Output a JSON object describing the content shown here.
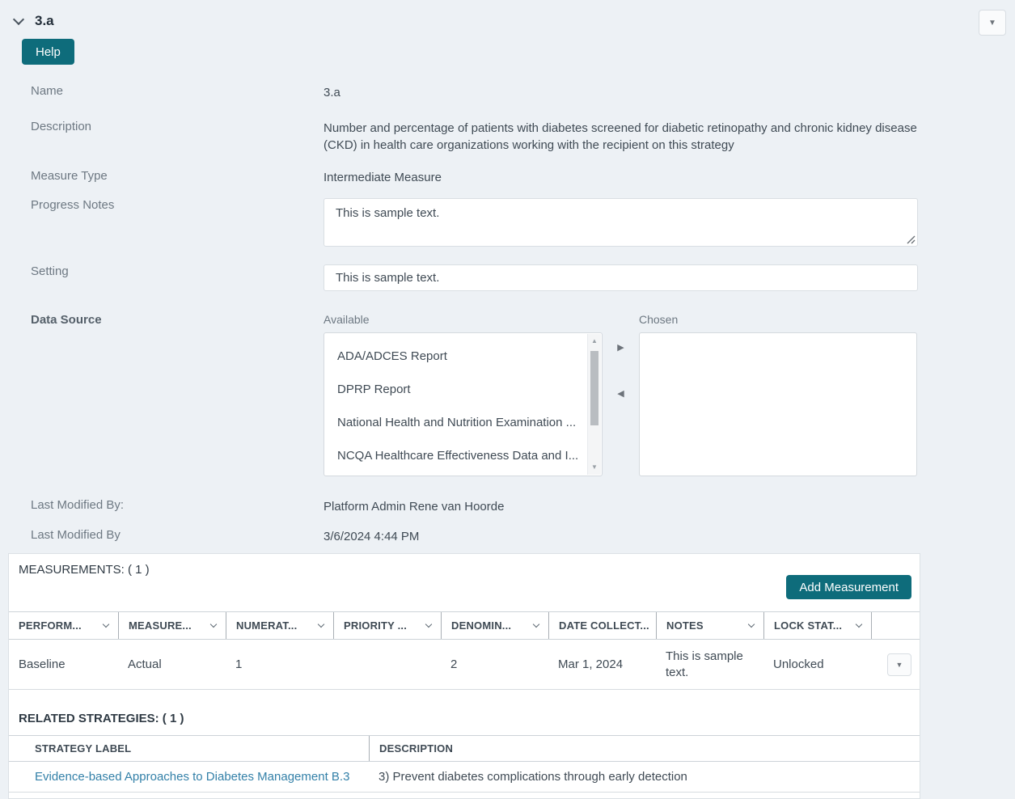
{
  "header": {
    "title": "3.a",
    "help_label": "Help"
  },
  "icons": {
    "caret_down_glyph": "▼",
    "caret_right_glyph": "▶",
    "caret_left_glyph": "◀",
    "scroll_up_glyph": "▲",
    "scroll_down_glyph": "▼"
  },
  "colors": {
    "accent_teal": "#0e6c7b",
    "link_blue": "#3380a8",
    "page_bg": "#edf1f5"
  },
  "fields": {
    "name": {
      "label": "Name",
      "value": "3.a"
    },
    "description": {
      "label": "Description",
      "value": "Number and percentage of patients with diabetes screened for diabetic retinopathy and chronic kidney disease (CKD) in health care organizations working with the recipient on this strategy"
    },
    "measure_type": {
      "label": "Measure Type",
      "value": "Intermediate Measure"
    },
    "progress_notes": {
      "label": "Progress Notes",
      "value": "This is sample text."
    },
    "setting": {
      "label": "Setting",
      "value": "This is sample text."
    },
    "data_source": {
      "label": "Data Source",
      "available_label": "Available",
      "chosen_label": "Chosen",
      "available_items": [
        "ADA/ADCES Report",
        "DPRP Report",
        "National Health and Nutrition Examination ...",
        "NCQA Healthcare Effectiveness Data and I..."
      ],
      "chosen_items": []
    },
    "last_modified_by_name": {
      "label": "Last Modified By:",
      "value": "Platform Admin Rene van Hoorde"
    },
    "last_modified_by_date": {
      "label": "Last Modified By",
      "value": "3/6/2024 4:44 PM"
    }
  },
  "measurements": {
    "title": "MEASUREMENTS: ( 1 )",
    "add_button": "Add Measurement",
    "columns": [
      {
        "label": "PERFORM...",
        "chevron": true
      },
      {
        "label": "MEASURE...",
        "chevron": true
      },
      {
        "label": "NUMERAT...",
        "chevron": true
      },
      {
        "label": "PRIORITY ...",
        "chevron": true
      },
      {
        "label": "DENOMIN...",
        "chevron": true
      },
      {
        "label": "DATE COLLECT...",
        "chevron": false
      },
      {
        "label": "NOTES",
        "chevron": true
      },
      {
        "label": "LOCK STAT...",
        "chevron": true
      }
    ],
    "row": [
      "Baseline",
      "Actual",
      "1",
      "",
      "2",
      "Mar 1, 2024",
      "This is sample text.",
      "Unlocked"
    ]
  },
  "related_strategies": {
    "title": "RELATED STRATEGIES: ( 1 )",
    "columns": [
      "STRATEGY LABEL",
      "DESCRIPTION"
    ],
    "rows": [
      {
        "strategy_label": "Evidence-based Approaches to Diabetes Management B.3",
        "description": "3) Prevent diabetes complications through early detection"
      }
    ]
  }
}
